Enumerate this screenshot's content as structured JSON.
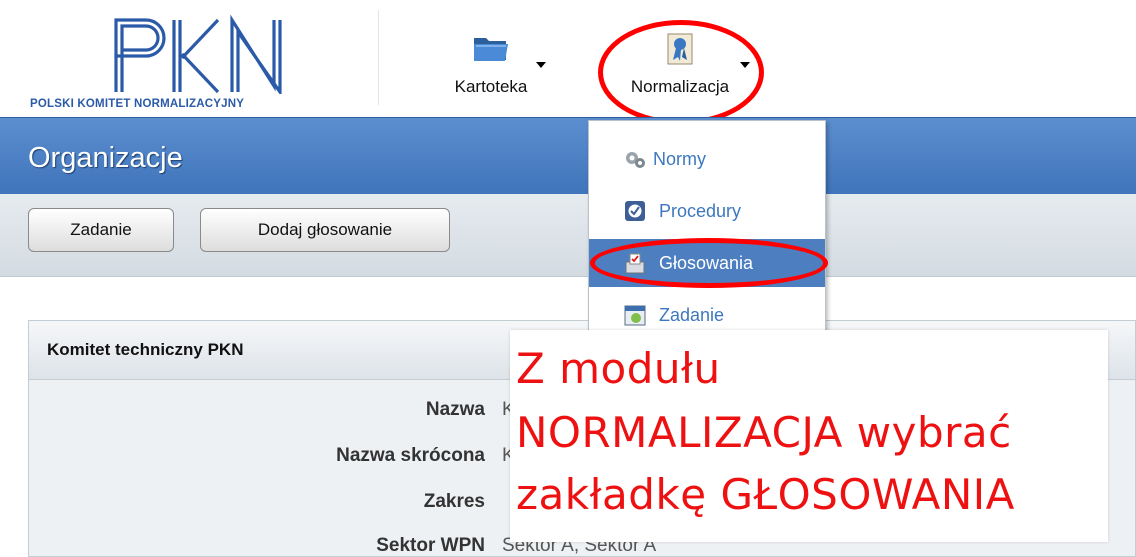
{
  "header": {
    "logo_text": "POLSKI KOMITET NORMALIZACYJNY",
    "logo_letters": "PKN",
    "nav": [
      {
        "label": "Kartoteka",
        "icon": "folder-icon"
      },
      {
        "label": "Normalizacja",
        "icon": "ribbon-award-icon"
      }
    ]
  },
  "title_bar": {
    "title": "Organizacje"
  },
  "toolbar": {
    "buttons": [
      "Zadanie",
      "Dodaj głosowanie"
    ]
  },
  "dropdown": {
    "items": [
      {
        "label": "Normy",
        "icon": "gears-icon",
        "selected": false
      },
      {
        "label": "Procedury",
        "icon": "checkmark-circle-icon",
        "selected": false
      },
      {
        "label": "Głosowania",
        "icon": "ballot-box-icon",
        "selected": true
      },
      {
        "label": "Zadanie",
        "icon": "calendar-icon",
        "selected": false
      }
    ]
  },
  "panel": {
    "title": "Komitet techniczny PKN",
    "fields": [
      {
        "label": "Nazwa",
        "value": "K"
      },
      {
        "label": "Nazwa skrócona",
        "value": "K"
      },
      {
        "label": "Zakres",
        "value": ""
      },
      {
        "label": "Sektor WPN",
        "value": "Sektor A, Sektor A"
      }
    ]
  },
  "annotation": {
    "lines": [
      "Z modułu",
      "NORMALIZACJA wybrać",
      "zakładkę GŁOSOWANIA"
    ]
  },
  "colors": {
    "accent": "#4d7fc0",
    "annotation_red": "#ff0000",
    "logo_blue": "#2b5aa8"
  }
}
